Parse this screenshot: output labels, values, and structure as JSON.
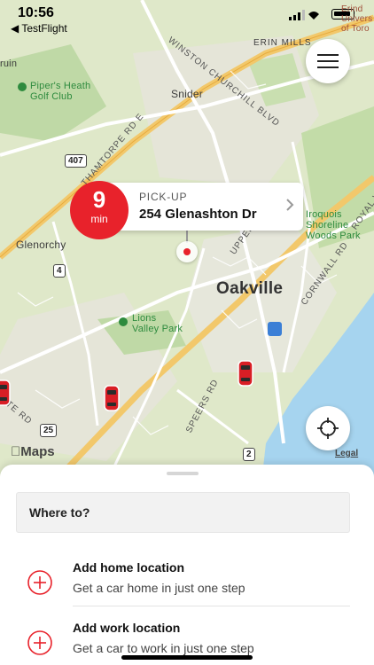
{
  "status_bar": {
    "time": "10:56",
    "back_app": "◀ TestFlight"
  },
  "map": {
    "labels": {
      "winston": "WINSTON CHURCHILL BLVD",
      "erin_mills": "ERIN MILLS",
      "snider": "Snider",
      "pipers": "Piper's Heath\nGolf Club",
      "thamthorpe": "THAMTORPE RD E",
      "glenorchy": "Glenorchy",
      "oakville": "Oakville",
      "upper": "UPPER",
      "lions": "Lions\nValley Park",
      "cornwall": "CORNWALL RD",
      "royal": "ROYAL W",
      "speers": "SPEERS RD",
      "ute_rd": "UTE RD",
      "iroquois": "Iroquois\nShoreline\nWoods Park",
      "erin_tr": "Erind",
      "toro": "Univers\nof Toro",
      "ruin": "ruin"
    },
    "highways": [
      "407",
      "4",
      "25",
      "2"
    ],
    "apple_maps": "Maps",
    "legal": "Legal"
  },
  "pickup": {
    "eta_value": "9",
    "eta_unit": "min",
    "label": "PICK-UP",
    "address": "254 Glenashton Dr"
  },
  "sheet": {
    "where_to": "Where to?",
    "options": [
      {
        "title": "Add home location",
        "subtitle": "Get a car home in just one step"
      },
      {
        "title": "Add work location",
        "subtitle": "Get a car to work in just one step"
      }
    ]
  },
  "colors": {
    "accent": "#e8222b",
    "map_base": "#dfe8c9",
    "water": "#a6d4ef"
  }
}
